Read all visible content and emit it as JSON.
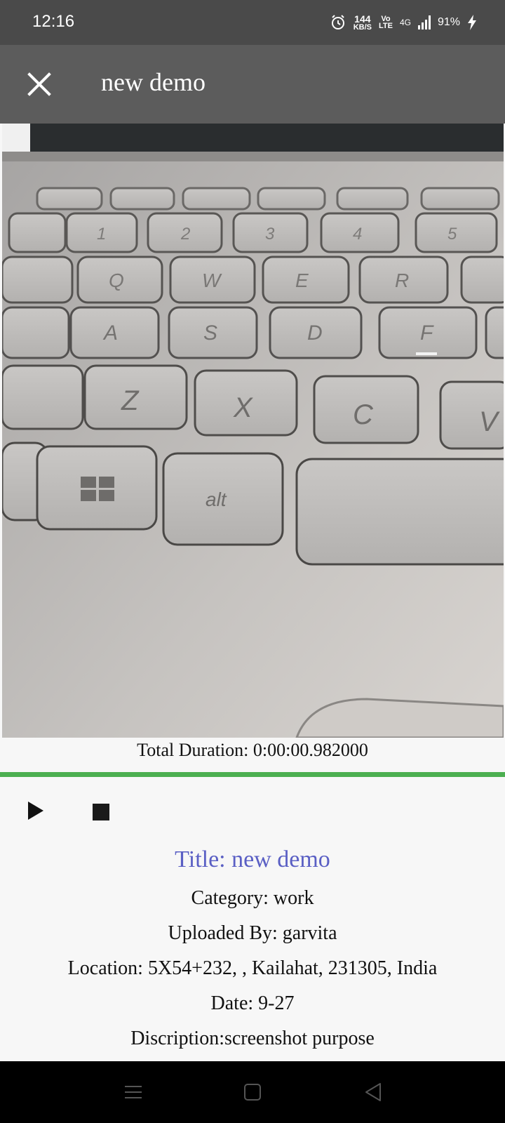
{
  "status_bar": {
    "time": "12:16",
    "net_speed": "144",
    "net_speed_unit": "KB/S",
    "volte_top": "Vo",
    "volte_bottom": "LTE",
    "network": "4G",
    "battery": "91%"
  },
  "app_bar": {
    "title": "new demo",
    "close_icon": "close-icon"
  },
  "video": {
    "description": "laptop keyboard frame"
  },
  "player": {
    "total_duration": "Total Duration: 0:00:00.982000",
    "progress": 1.0,
    "accent_color": "#4caf50",
    "play_icon": "play-icon",
    "stop_icon": "stop-icon"
  },
  "details": {
    "title": "Title: new demo",
    "category": "Category: work",
    "uploaded_by": "Uploaded By: garvita",
    "location": "Location: 5X54+232, , Kailahat, 231305, India",
    "date": "Date: 9-27",
    "description": "Discription:screenshot purpose",
    "title_color": "#5a5fc4"
  },
  "nav_bar": {
    "menu_icon": "menu-icon",
    "home_icon": "home-icon",
    "back_icon": "back-icon"
  }
}
